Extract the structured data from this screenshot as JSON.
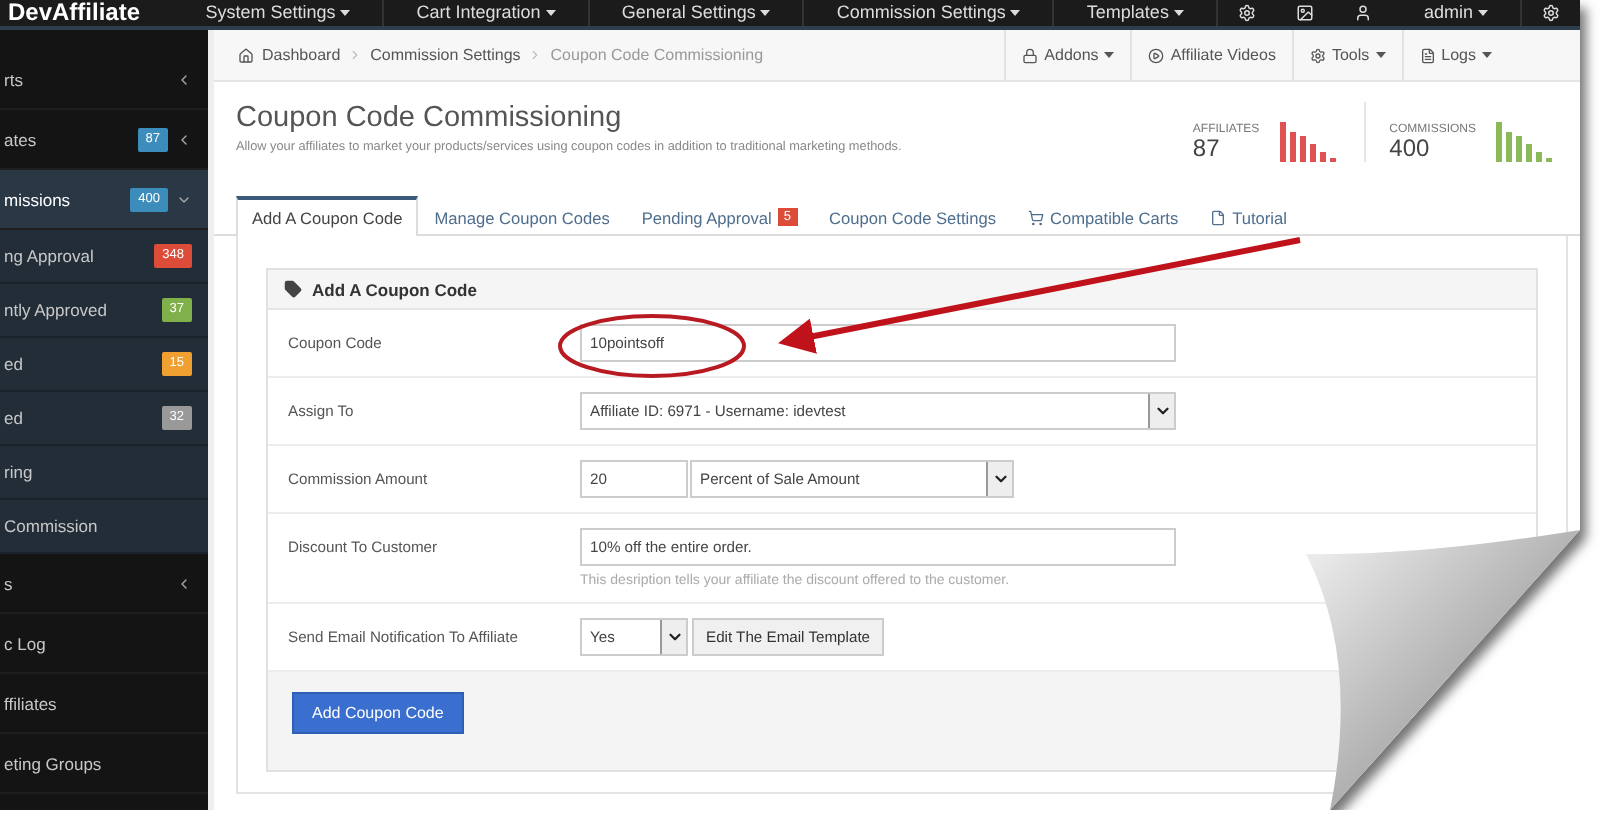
{
  "top_nav": {
    "logo": "DevAffiliate",
    "menus": [
      "System Settings",
      "Cart Integration",
      "General Settings",
      "Commission Settings",
      "Templates"
    ],
    "user": "admin"
  },
  "sidebar": {
    "items": [
      {
        "label": "rts",
        "expanded": false,
        "selected": false
      },
      {
        "label": "ates",
        "badge": "87",
        "color": "#3c8dbc",
        "expanded": false,
        "selected": false
      },
      {
        "label": "missions",
        "badge": "400",
        "color": "#3c8dbc",
        "expanded": true,
        "selected": true,
        "children": [
          {
            "label": "ng Approval",
            "badge": "348",
            "color": "#dd4b39"
          },
          {
            "label": "ntly Approved",
            "badge": "37",
            "color": "#7fb04a"
          },
          {
            "label": "ed",
            "badge": "15",
            "color": "#f0a030"
          },
          {
            "label": "ed",
            "badge": "32",
            "color": "#999999"
          },
          {
            "label": "ring"
          },
          {
            "label": "Commission"
          }
        ]
      },
      {
        "label": "s",
        "expanded": false,
        "selected": false
      },
      {
        "label": "c Log",
        "selected": false
      },
      {
        "label": "ffiliates",
        "selected": false
      },
      {
        "label": "eting Groups",
        "selected": false
      }
    ]
  },
  "breadcrumb": [
    "Dashboard",
    "Commission Settings",
    "Coupon Code Commissioning"
  ],
  "toolbar": [
    {
      "kind": "lock",
      "label": "Addons",
      "dropdown": true
    },
    {
      "kind": "video",
      "label": "Affiliate Videos",
      "dropdown": false
    },
    {
      "kind": "gear",
      "label": "Tools",
      "dropdown": true
    },
    {
      "kind": "file",
      "label": "Logs",
      "dropdown": true
    }
  ],
  "header": {
    "title": "Coupon Code Commissioning",
    "subtitle": "Allow your affiliates to market your products/services using coupon codes in addition to traditional marketing methods."
  },
  "stats": [
    {
      "label": "AFFILIATES",
      "value": "87",
      "color": "#e05252"
    },
    {
      "label": "COMMISSIONS",
      "value": "400",
      "color": "#8cb85c"
    }
  ],
  "tabs": [
    {
      "kind": "plain",
      "label": "Add A Coupon Code",
      "selected": true
    },
    {
      "kind": "plain",
      "label": "Manage Coupon Codes",
      "selected": false
    },
    {
      "kind": "plain",
      "label": "Pending Approval",
      "badge": "5",
      "selected": false
    },
    {
      "kind": "plain",
      "label": "Coupon Code Settings",
      "selected": false
    },
    {
      "kind": "cart",
      "label": "Compatible Carts",
      "selected": false
    },
    {
      "kind": "file",
      "label": "Tutorial",
      "selected": false
    }
  ],
  "panel": {
    "title": "Add A Coupon Code",
    "rows": [
      {
        "kind": "text",
        "label": "Coupon Code",
        "value": "10pointsoff"
      },
      {
        "kind": "select",
        "label": "Assign To",
        "value": "Affiliate ID: 6971 - Username: idevtest"
      },
      {
        "kind": "amount",
        "label": "Commission Amount",
        "value": "20",
        "unit": "Percent of Sale Amount"
      },
      {
        "kind": "text",
        "label": "Discount To Customer",
        "value": "10% off the entire order.",
        "help": "This desription tells your affiliate the discount offered to the customer."
      },
      {
        "kind": "select_button",
        "label": "Send Email Notification To Affiliate",
        "value": "Yes",
        "button": "Edit The Email Template"
      }
    ],
    "submit": "Add Coupon Code"
  }
}
